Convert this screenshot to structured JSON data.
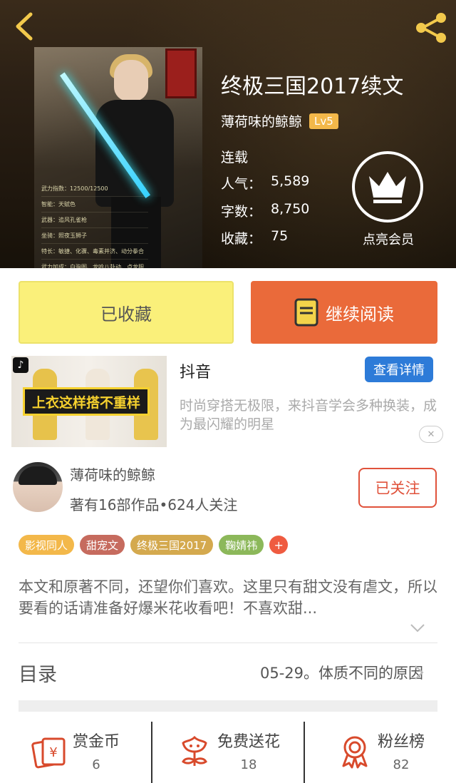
{
  "book": {
    "title": "终极三国2017续文",
    "author": "薄荷味的鲸鲸",
    "level": "Lv5",
    "status": "连载",
    "stats": [
      {
        "key": "人气：",
        "value": "5,589"
      },
      {
        "key": "字数：",
        "value": "8,750"
      },
      {
        "key": "收藏：",
        "value": "75"
      }
    ],
    "cover_stats": [
      "武力指数：12500/12500",
      "智能：天赋色",
      "武器：追风孔雀枪",
      "坐骑：照夜玉狮子",
      "特长：敏捷、化骤、毒素并济、动分拳合",
      "武力加成：白驹图、龙吟八卦动、点龙胆"
    ]
  },
  "member": {
    "label": "点亮会员"
  },
  "actions": {
    "collect_label": "已收藏",
    "read_label": "继续阅读"
  },
  "ad": {
    "banner_text": "上衣这样搭不重样",
    "title": "抖音",
    "button_label": "查看详情",
    "description": "时尚穿搭无极限，来抖音学会多种换装，成为最闪耀的明星"
  },
  "author_card": {
    "name": "薄荷味的鲸鲸",
    "info": "著有16部作品•624人关注",
    "follow_label": "已关注"
  },
  "tags": [
    {
      "label": "影视同人",
      "color": "#f3b84a"
    },
    {
      "label": "甜宠文",
      "color": "#c66b5e"
    },
    {
      "label": "终极三国2017",
      "color": "#d4a94e"
    },
    {
      "label": "鞠婧祎",
      "color": "#8cb85a"
    }
  ],
  "tag_add_label": "+",
  "description": "本文和原著不同，还望你们喜欢。这里只有甜文没有虐文，所以要看的话请准备好爆米花收看吧！不喜欢甜...",
  "toc": {
    "label": "目录",
    "latest": "05-29。体质不同的原因"
  },
  "bottom_bar": [
    {
      "label": "赏金币",
      "value": "6",
      "icon": "coin-envelope-icon"
    },
    {
      "label": "免费送花",
      "value": "18",
      "icon": "flower-icon"
    },
    {
      "label": "粉丝榜",
      "value": "82",
      "icon": "ribbon-medal-icon"
    }
  ],
  "colors": {
    "accent_orange": "#ea6a3a",
    "collect_yellow": "#faf07a",
    "follow_red": "#e0523b",
    "ad_blue": "#2d7bd8",
    "icon_red": "#d84a2c"
  }
}
